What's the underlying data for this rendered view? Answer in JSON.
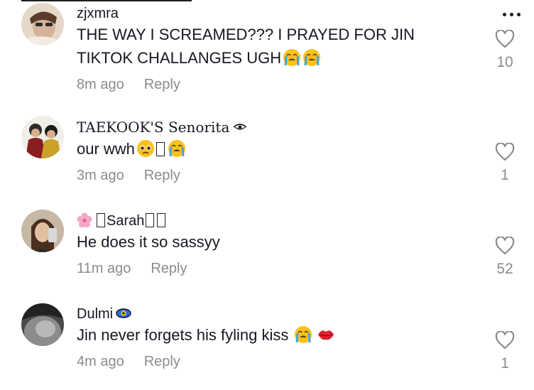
{
  "more_label": "More options",
  "comments": [
    {
      "username": "zjxmra",
      "text": "THE WAY I SCREAMED??? I PRAYED FOR JIN TIKTOK CHALLANGES UGH",
      "time": "8m ago",
      "reply": "Reply",
      "likes": "10"
    },
    {
      "username": "TAEKOOK'S Senorita",
      "text": "our wwh",
      "time": "3m ago",
      "reply": "Reply",
      "likes": "1"
    },
    {
      "username": "Sarah",
      "text": "He does it so sassyy",
      "time": "11m ago",
      "reply": "Reply",
      "likes": "52"
    },
    {
      "username": "Dulmi",
      "text": "Jin never forgets his fyling kiss",
      "time": "4m ago",
      "reply": "Reply",
      "likes": "1"
    }
  ],
  "icons": {
    "heart": "heart-outline-icon",
    "more": "three-dots-icon",
    "crying": "loudly-crying-face-emoji",
    "pleading": "pleading-face-emoji",
    "kiss": "kiss-lips-emoji",
    "flower": "cherry-blossom-emoji",
    "eye": "eye-emoji"
  }
}
